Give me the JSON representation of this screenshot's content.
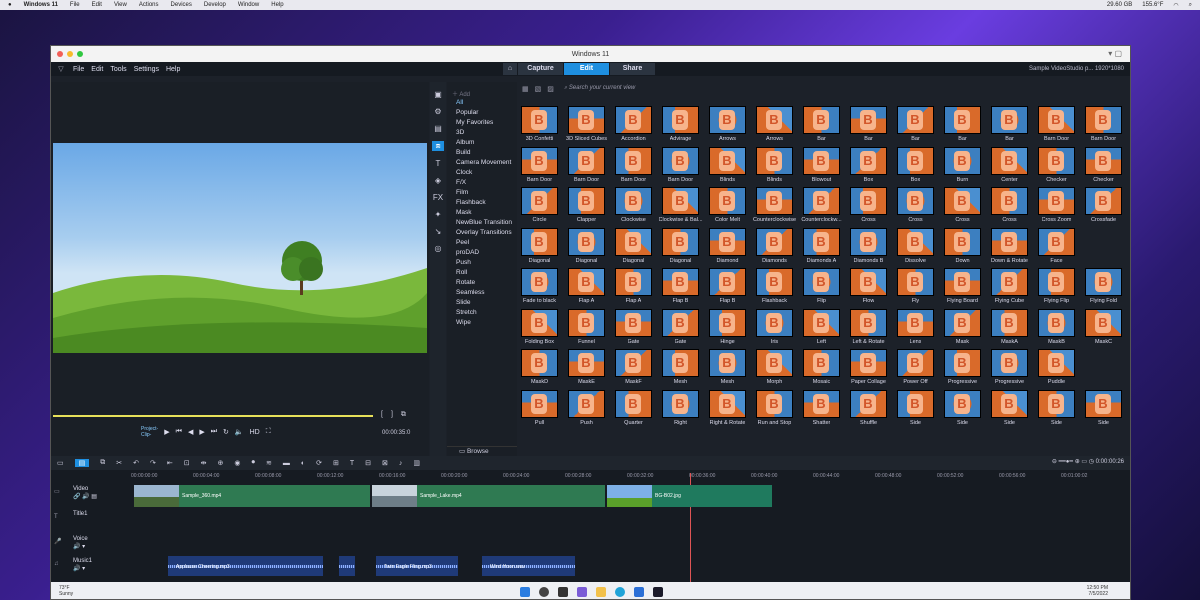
{
  "mac_menubar": {
    "app": "Windows 11",
    "menus": [
      "File",
      "Edit",
      "View",
      "Actions",
      "Devices",
      "Develop",
      "Window",
      "Help"
    ],
    "storage": "29.60 GB",
    "percent": "155.6°F"
  },
  "window": {
    "title": "Windows 11",
    "menu": [
      "File",
      "Edit",
      "Tools",
      "Settings",
      "Help"
    ],
    "tabs": [
      "Capture",
      "Edit",
      "Share"
    ],
    "active_tab": "Edit",
    "project_info": "Sample VideoStudio p...  1920*1080"
  },
  "preview": {
    "project_label": "Project-",
    "clip_label": "Clip-",
    "hd": "HD",
    "timecode": "00:00:35:0"
  },
  "library": {
    "add_label": "Add",
    "search_placeholder": "Search your current view",
    "browse_label": "Browse",
    "categories": [
      "All",
      "Popular",
      "My Favorites",
      "3D",
      "Album",
      "Build",
      "Camera Movement",
      "Clock",
      "F/X",
      "Film",
      "Flashback",
      "Mask",
      "NewBlue Transition",
      "Overlay Transitions",
      "Peel",
      "proDAD",
      "Push",
      "Roll",
      "Rotate",
      "Seamless",
      "Slide",
      "Stretch",
      "Wipe"
    ],
    "active_category": "All",
    "transitions": [
      "3D Confetti",
      "3D Sliced Cubes",
      "Accordion",
      "Advirage",
      "Arrows",
      "Arrows",
      "Bar",
      "Bar",
      "Bar",
      "Bar",
      "Bar",
      "Barn Door",
      "Barn Door",
      "Barn Door",
      "Barn Door",
      "Barn Door",
      "Barn Door",
      "Blinds",
      "Blinds",
      "Blowout",
      "Box",
      "Box",
      "Burn",
      "Center",
      "Checker",
      "Checker",
      "Circle",
      "Clapper",
      "Clockwise",
      "Clockwise & Bal...",
      "Color Melt",
      "Counterclockwise",
      "Counterclockw...",
      "Cross",
      "Cross",
      "Cross",
      "Cross",
      "Cross Zoom",
      "Crossfade",
      "Diagonal",
      "Diagonal",
      "Diagonal",
      "Diagonal",
      "Diamond",
      "Diamonds",
      "Diamonds A",
      "Diamonds B",
      "Dissolve",
      "Down",
      "Down & Rotate",
      "Face",
      "",
      "Fade to black",
      "Flap A",
      "Flap A",
      "Flap B",
      "Flap B",
      "Flashback",
      "Flip",
      "Flow",
      "Fly",
      "Flying Board",
      "Flying Cube",
      "Flying Flip",
      "Flying Fold",
      "Folding Box",
      "Funnel",
      "Gate",
      "Gate",
      "Hinge",
      "Iris",
      "Left",
      "Left & Rotate",
      "Lens",
      "Mask",
      "MaskA",
      "MaskB",
      "MaskC",
      "MaskD",
      "MaskE",
      "MaskF",
      "Mesh",
      "Mesh",
      "Morph",
      "Mosaic",
      "Paper Collage",
      "Power Off",
      "Progressive",
      "Progressive",
      "Puddle",
      "",
      "Pull",
      "Push",
      "Quarter",
      "Right",
      "Right & Rotate",
      "Run and Stop",
      "Shatter",
      "Shuffle",
      "Side",
      "Side",
      "Side",
      "Side",
      "Side"
    ]
  },
  "timeline": {
    "ruler": [
      "00:00:00:00",
      "00:00:04:00",
      "00:00:08:00",
      "00:00:12:00",
      "00:00:16:00",
      "00:00:20:00",
      "00:00:24:00",
      "00:00:28:00",
      "00:00:32:00",
      "00:00:36:00",
      "00:00:40:00",
      "00:00:44:00",
      "00:00:48:00",
      "00:00:52:00",
      "00:00:56:00",
      "00:01:00:02"
    ],
    "zoom_time": "0:00:00:26",
    "tracks": [
      "Video",
      "Title1",
      "Voice",
      "Music1"
    ],
    "video_clips": [
      "Sample_360.mp4",
      "Sample_Lake.mp4",
      "BG-B02.jpg"
    ],
    "music_clips": [
      "Applause Cheering.mp3",
      "Twin Eagle Fling.mp3",
      "Wind Hoon.wav"
    ]
  },
  "taskbar": {
    "temp": "73°F",
    "weather": "Sunny",
    "time": "12:50 PM",
    "date": "7/5/2022"
  }
}
